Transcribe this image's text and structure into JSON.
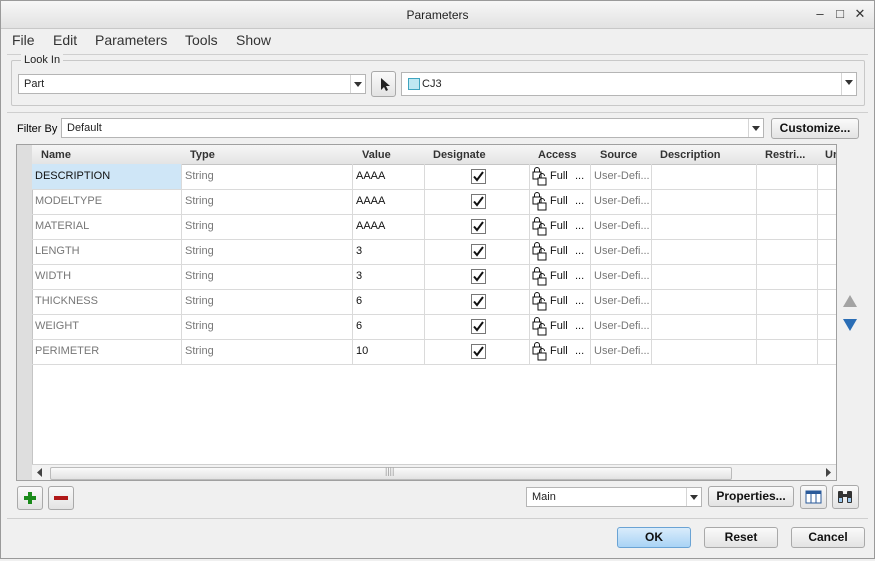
{
  "window": {
    "title": "Parameters"
  },
  "menu": {
    "file": "File",
    "edit": "Edit",
    "parameters": "Parameters",
    "tools": "Tools",
    "show": "Show"
  },
  "look_in": {
    "label": "Look In",
    "type_value": "Part",
    "model_value": "CJ3"
  },
  "filter": {
    "label": "Filter By",
    "value": "Default",
    "customize": "Customize..."
  },
  "table": {
    "headers": {
      "name": "Name",
      "type": "Type",
      "value": "Value",
      "designate": "Designate",
      "access": "Access",
      "source": "Source",
      "description": "Description",
      "restricted": "Restri...",
      "unit": "Ur"
    },
    "rows": [
      {
        "name": "DESCRIPTION",
        "type": "String",
        "value": "AAAA",
        "access": "Full",
        "access_more": "...",
        "source": "User-Defi..."
      },
      {
        "name": "MODELTYPE",
        "type": "String",
        "value": "AAAA",
        "access": "Full",
        "access_more": "...",
        "source": "User-Defi..."
      },
      {
        "name": "MATERIAL",
        "type": "String",
        "value": "AAAA",
        "access": "Full",
        "access_more": "...",
        "source": "User-Defi..."
      },
      {
        "name": "LENGTH",
        "type": "String",
        "value": "3",
        "access": "Full",
        "access_more": "...",
        "source": "User-Defi..."
      },
      {
        "name": "WIDTH",
        "type": "String",
        "value": "3",
        "access": "Full",
        "access_more": "...",
        "source": "User-Defi..."
      },
      {
        "name": "THICKNESS",
        "type": "String",
        "value": "6",
        "access": "Full",
        "access_more": "...",
        "source": "User-Defi..."
      },
      {
        "name": "WEIGHT",
        "type": "String",
        "value": "6",
        "access": "Full",
        "access_more": "...",
        "source": "User-Defi..."
      },
      {
        "name": "PERIMETER",
        "type": "String",
        "value": "10",
        "access": "Full",
        "access_more": "...",
        "source": "User-Defi..."
      }
    ]
  },
  "bottom": {
    "scope_value": "Main",
    "properties": "Properties..."
  },
  "dialog": {
    "ok": "OK",
    "reset": "Reset",
    "cancel": "Cancel"
  },
  "colors": {
    "accent": "#a9d3f5",
    "selection": "#cfe6f7",
    "add": "#1a8a1a",
    "remove": "#b01818",
    "nav": "#2a6db5"
  }
}
